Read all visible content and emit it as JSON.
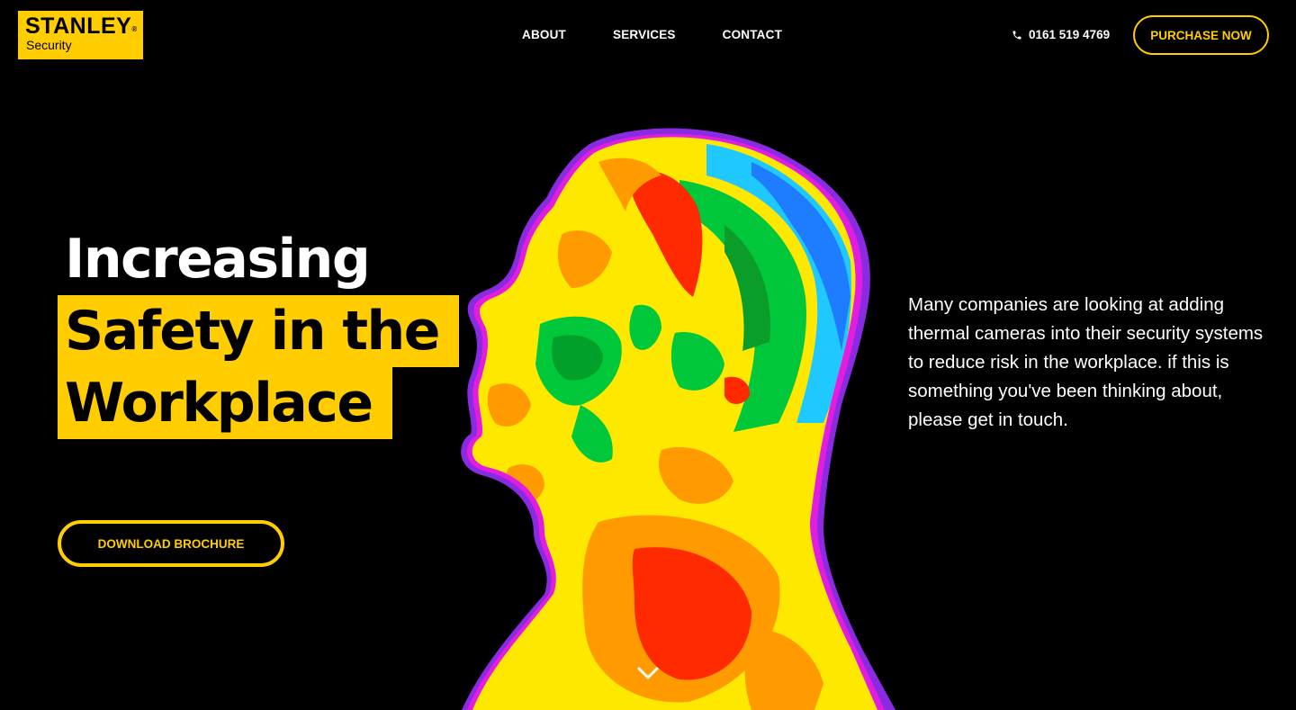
{
  "brand": {
    "name": "STANLEY",
    "mark": "®",
    "sub": "Security",
    "color": "#FFCD00"
  },
  "nav": {
    "items": [
      {
        "label": "ABOUT"
      },
      {
        "label": "SERVICES"
      },
      {
        "label": "CONTACT"
      }
    ]
  },
  "header": {
    "phone_icon": "phone-icon",
    "phone": "0161 519 4769",
    "purchase_label": "PURCHASE NOW"
  },
  "hero": {
    "headline": {
      "line1": "Increasing",
      "line2": "Safety in the",
      "line3": "Workplace"
    },
    "description": "Many companies are looking at adding thermal cameras into their security systems to reduce risk in the workplace. if this is something you've been thinking about, please get in touch.",
    "download_label": "DOWNLOAD BROCHURE",
    "scroll_icon": "chevron-down-icon"
  },
  "colors": {
    "background": "#000000",
    "accent": "#FFCD00",
    "text": "#FFFFFF"
  }
}
